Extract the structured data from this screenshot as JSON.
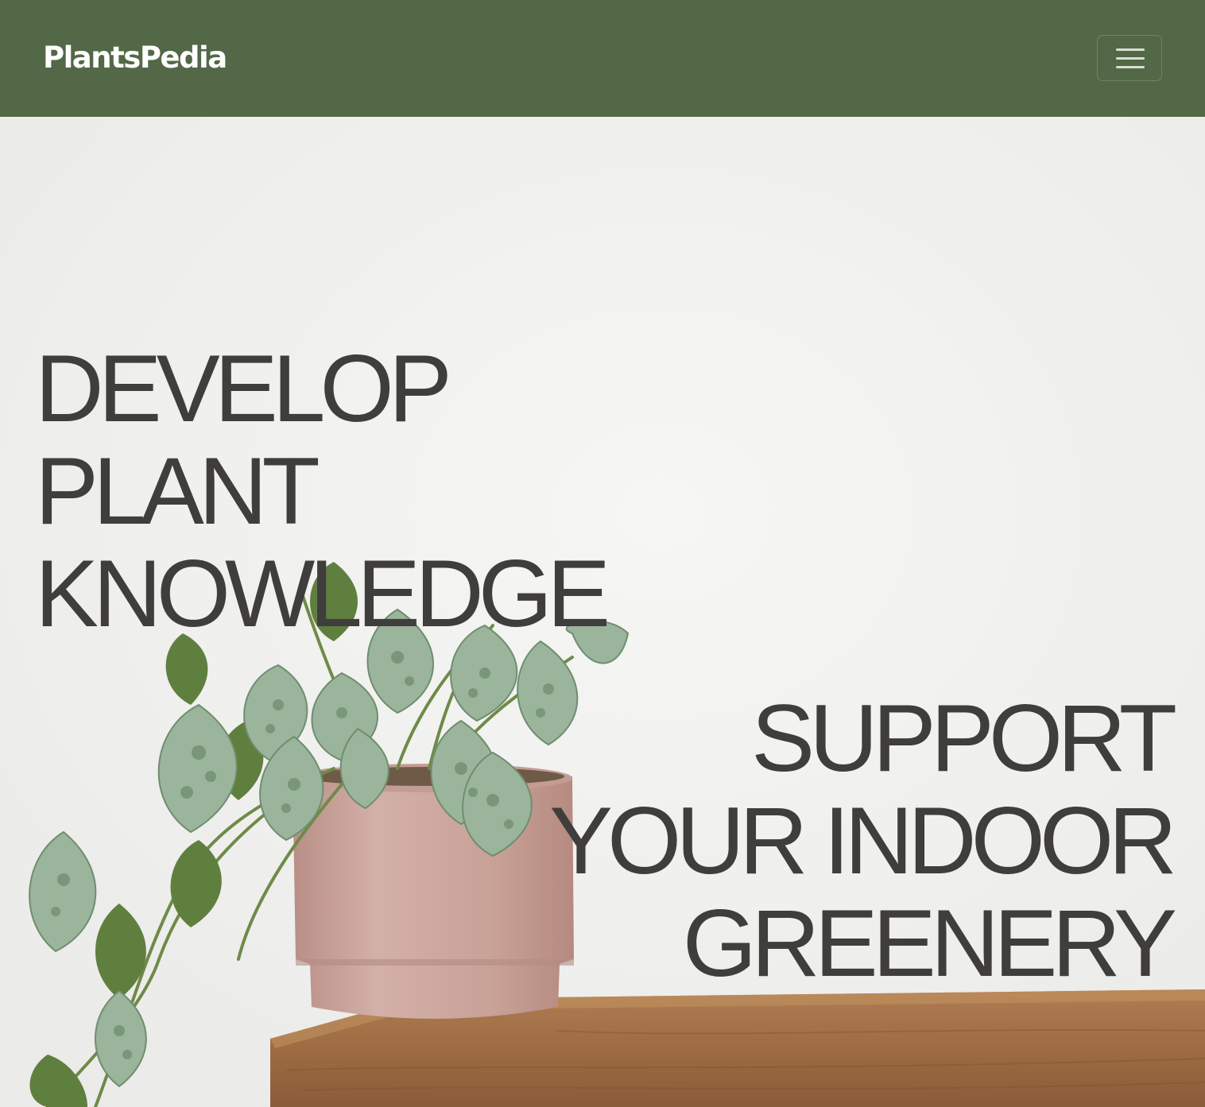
{
  "navbar": {
    "brand": "PlantsPedia",
    "toggler_icon": "menu-icon"
  },
  "hero": {
    "headline_left": [
      "DEVELOP",
      "PLANT",
      "KNOWLEDGE"
    ],
    "headline_right": [
      "SUPPORT",
      "YOUR INDOOR",
      "GREENERY"
    ],
    "image_subject": "potted-pothos-plant-image",
    "colors": {
      "nav_bg": "#536846",
      "headline": "#403d3d",
      "pot": "#caa59d",
      "shelf": "#a06f45",
      "leaf_dark": "#5b7a4a",
      "leaf_silver": "#9fb6a0"
    }
  }
}
